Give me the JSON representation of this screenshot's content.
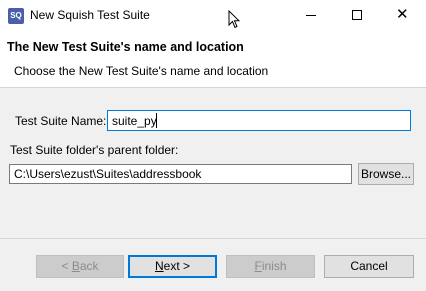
{
  "window": {
    "app_icon_text": "SQ",
    "title": "New Squish Test Suite",
    "icons": [
      "app-icon",
      "minimize-icon",
      "maximize-icon",
      "close-icon",
      "cursor-icon"
    ]
  },
  "header": {
    "title": "The New Test Suite's name and location",
    "description": "Choose the New Test Suite's name and location"
  },
  "form": {
    "name_label": "Test Suite Name:",
    "name_value": "suite_py",
    "folder_label": "Test Suite folder's parent folder:",
    "folder_value": "C:\\Users\\ezust\\Suites\\addressbook",
    "browse_label": "Browse..."
  },
  "buttons": {
    "back": {
      "prefix": "< ",
      "mnemonic": "B",
      "rest": "ack"
    },
    "next": {
      "mnemonic": "N",
      "rest": "ext >"
    },
    "finish": {
      "mnemonic": "F",
      "rest": "inish"
    },
    "cancel": "Cancel"
  },
  "colors": {
    "focus_accent": "#0078d7",
    "app_icon": "#4b5fa8"
  }
}
